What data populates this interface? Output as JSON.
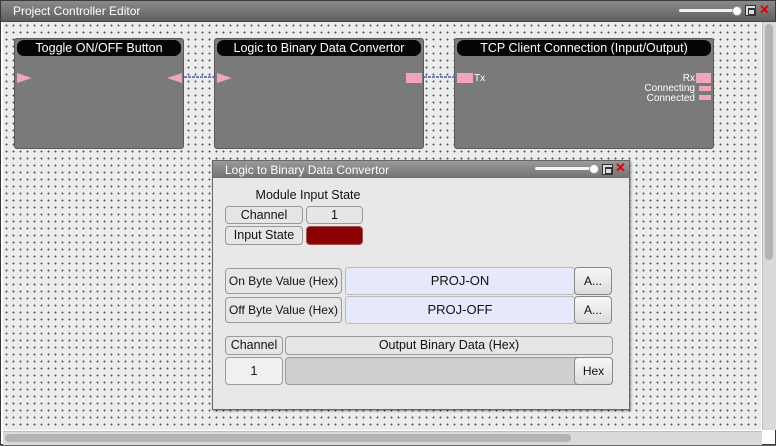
{
  "window": {
    "title": "Project Controller Editor"
  },
  "colors": {
    "port": "#efa6b6",
    "input_state": "#8b0000",
    "title_black": "#050505",
    "close": "#dd0000"
  },
  "nodes": [
    {
      "title": "Toggle ON/OFF Button"
    },
    {
      "title": "Logic to Binary Data Convertor"
    },
    {
      "title": "TCP Client Connection (Input/Output)",
      "ports": {
        "tx": "Tx",
        "rx": "Rx",
        "connecting": "Connecting",
        "connected": "Connected"
      }
    }
  ],
  "dialog": {
    "title": "Logic to Binary Data Convertor",
    "section_title": "Module Input State",
    "channel_label": "Channel",
    "channel_value": "1",
    "input_state_label": "Input State",
    "on_byte_label": "On Byte Value (Hex)",
    "on_byte_value": "PROJ-ON",
    "off_byte_label": "Off Byte Value (Hex)",
    "off_byte_value": "PROJ-OFF",
    "ascii_button": "A...",
    "output_channel_label": "Channel",
    "output_header": "Output Binary Data (Hex)",
    "output_channel_value": "1",
    "output_value": "",
    "hex_button": "Hex"
  },
  "icons": [
    "maximize-icon",
    "close-icon",
    "slider-knob"
  ]
}
